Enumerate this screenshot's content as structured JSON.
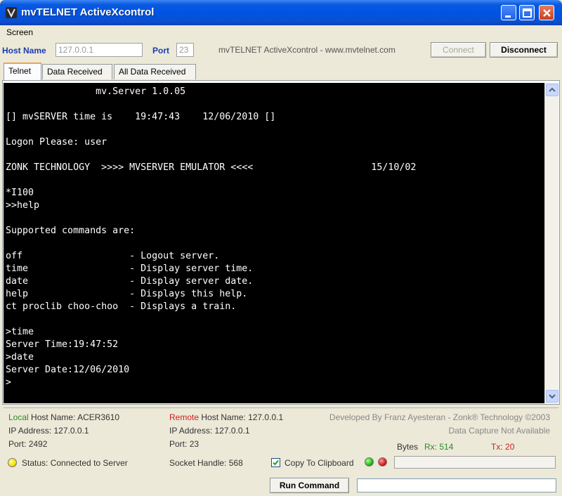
{
  "window": {
    "title": "mvTELNET ActiveXcontrol"
  },
  "menu": {
    "screen": "Screen"
  },
  "connection": {
    "host_label": "Host Name",
    "host_value": "127.0.0.1",
    "port_label": "Port",
    "port_value": "23",
    "banner": "mvTELNET ActiveXcontrol - www.mvtelnet.com",
    "connect_label": "Connect",
    "disconnect_label": "Disconnect"
  },
  "tabs": [
    {
      "label": "Telnet",
      "active": true
    },
    {
      "label": "Data Received",
      "active": false
    },
    {
      "label": "All Data Received",
      "active": false
    }
  ],
  "terminal": {
    "lines": [
      "                mv.Server 1.0.05",
      "",
      "[] mvSERVER time is    19:47:43    12/06/2010 []",
      "",
      "Logon Please: user",
      "",
      "ZONK TECHNOLOGY  >>>> MVSERVER EMULATOR <<<<                     15/10/02",
      "",
      "*I100",
      ">>help",
      "",
      "Supported commands are:",
      "",
      "off                   - Logout server.",
      "time                  - Display server time.",
      "date                  - Display server date.",
      "help                  - Displays this help.",
      "ct proclib choo-choo  - Displays a train.",
      "",
      ">time",
      "Server Time:19:47:52",
      ">date",
      "Server Date:12/06/2010",
      ">"
    ]
  },
  "status": {
    "local_word": "Local",
    "local_host_label": "Host Name:",
    "local_host": "ACER3610",
    "local_ip_label": "IP Address:",
    "local_ip": "127.0.0.1",
    "local_port_label": "Port:",
    "local_port": "2492",
    "remote_word": "Remote",
    "remote_host_label": "Host Name:",
    "remote_host": "127.0.0.1",
    "remote_ip_label": "IP Address:",
    "remote_ip": "127.0.0.1",
    "remote_port_label": "Port:",
    "remote_port": "23",
    "developed_by": "Developed By Franz Ayesteran - Zonk® Technology ©2003",
    "data_capture": "Data Capture Not Available",
    "bytes_label": "Bytes",
    "rx_label": "Rx:",
    "rx_value": "514",
    "tx_label": "Tx:",
    "tx_value": "20",
    "status_text": "Status: Connected to Server",
    "socket_label": "Socket Handle:",
    "socket_value": "568",
    "clipboard_label": "Copy To Clipboard",
    "clipboard_checked": true,
    "run_command_label": "Run Command"
  },
  "colors": {
    "title_blue": "#0054e3",
    "terminal_bg": "#000000",
    "terminal_fg": "#ffffff",
    "local_green": "#2c8a22",
    "remote_red": "#d11c1c",
    "label_blue": "#1a3cb0"
  }
}
